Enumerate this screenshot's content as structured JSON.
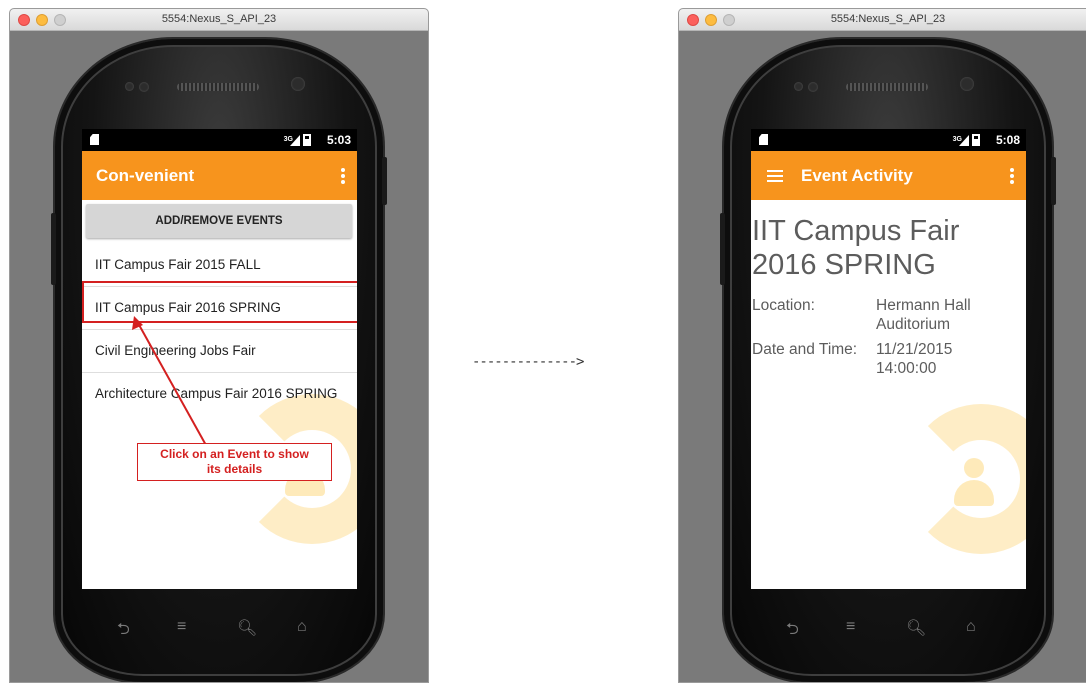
{
  "flow_arrow": "-------------->",
  "left": {
    "window_title": "5554:Nexus_S_API_23",
    "status_time": "5:03",
    "network_label": "3G",
    "app_title": "Con-venient",
    "add_button_label": "ADD/REMOVE EVENTS",
    "events": [
      "IIT Campus Fair 2015 FALL",
      "IIT Campus Fair 2016 SPRING",
      "Civil Engineering Jobs Fair",
      "Architecture Campus Fair 2016 SPRING"
    ],
    "callout_line1": "Click on an Event to show",
    "callout_line2": "its details"
  },
  "right": {
    "window_title": "5554:Nexus_S_API_23",
    "status_time": "5:08",
    "network_label": "3G",
    "app_title": "Event Activity",
    "event_title": "IIT Campus Fair 2016 SPRING",
    "location_label": "Location:",
    "location_value": "Hermann Hall Auditorium",
    "datetime_label": "Date and Time:",
    "datetime_value": "11/21/2015 14:00:00"
  },
  "colors": {
    "accent": "#f7941d",
    "annotation": "#d42020",
    "watermark": "#fdd882"
  },
  "icons": {
    "nav": [
      "back-icon",
      "recent-apps-icon",
      "search-icon",
      "home-icon"
    ]
  }
}
